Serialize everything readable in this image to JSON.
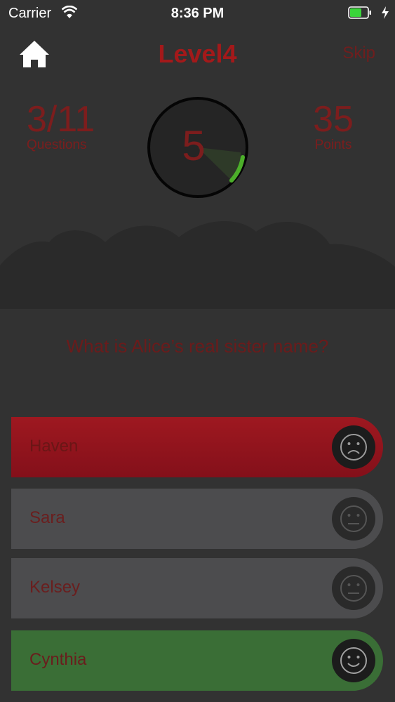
{
  "status_bar": {
    "carrier": "Carrier",
    "time": "8:36 PM",
    "battery_color": "#3ad43a"
  },
  "header": {
    "title": "Level4",
    "skip_label": "Skip"
  },
  "stats": {
    "questions_value": "3/11",
    "questions_label": "Questions",
    "points_value": "35",
    "points_label": "Points"
  },
  "timer": {
    "value": "5",
    "progress_color": "#4caf2a"
  },
  "question": {
    "text": "What is Alice’s real sister name?"
  },
  "answers": [
    {
      "label": "Haven",
      "state": "wrong",
      "face": "sad-face-icon",
      "color": "#9e1820"
    },
    {
      "label": "Sara",
      "state": "neutral",
      "face": "neutral-face-icon",
      "color": "#4c4c4e"
    },
    {
      "label": "Kelsey",
      "state": "neutral",
      "face": "neutral-face-icon",
      "color": "#4c4c4e"
    },
    {
      "label": "Cynthia",
      "state": "correct",
      "face": "smile-face-icon",
      "color": "#3a6e36"
    }
  ]
}
